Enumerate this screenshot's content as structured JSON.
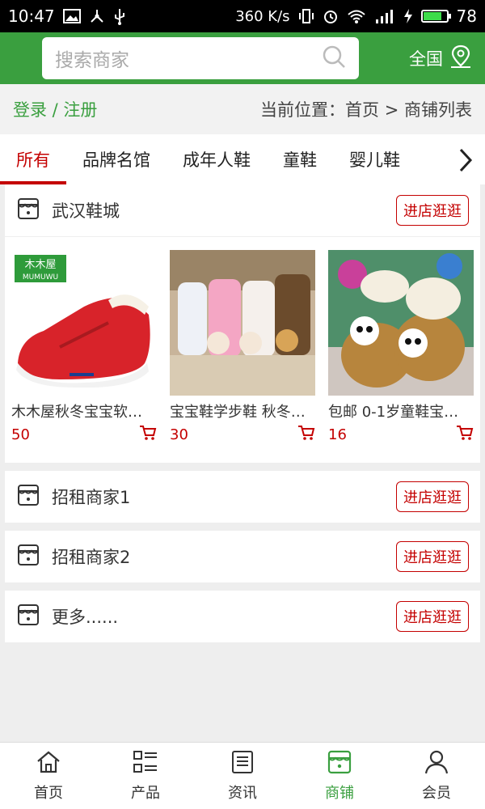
{
  "status_bar": {
    "time": "10:47",
    "net_speed": "360 K/s",
    "battery": "78"
  },
  "header": {
    "search_placeholder": "搜索商家",
    "region": "全国"
  },
  "breadcrumb": {
    "login": "登录 / 注册",
    "location": "当前位置：首页 > 商铺列表"
  },
  "tabs": [
    "所有",
    "品牌名馆",
    "成年人鞋",
    "童鞋",
    "婴儿鞋"
  ],
  "shops": [
    {
      "name": "武汉鞋城",
      "button": "进店逛逛",
      "products": [
        {
          "title": "木木屋秋冬宝宝软…",
          "price": "50",
          "brand": "木木屋",
          "brand_sub": "MUMUWU"
        },
        {
          "title": "宝宝鞋学步鞋 秋冬…",
          "price": "30"
        },
        {
          "title": "包邮 0-1岁童鞋宝…",
          "price": "16"
        }
      ]
    },
    {
      "name": "招租商家1",
      "button": "进店逛逛"
    },
    {
      "name": "招租商家2",
      "button": "进店逛逛"
    },
    {
      "name": "更多......",
      "button": "进店逛逛"
    }
  ],
  "bottom_nav": [
    {
      "label": "首页",
      "icon": "home-icon"
    },
    {
      "label": "产品",
      "icon": "list-icon"
    },
    {
      "label": "资讯",
      "icon": "news-icon"
    },
    {
      "label": "商铺",
      "icon": "store-icon"
    },
    {
      "label": "会员",
      "icon": "user-icon"
    }
  ],
  "colors": {
    "green": "#3a9f3f",
    "red": "#c40000"
  }
}
